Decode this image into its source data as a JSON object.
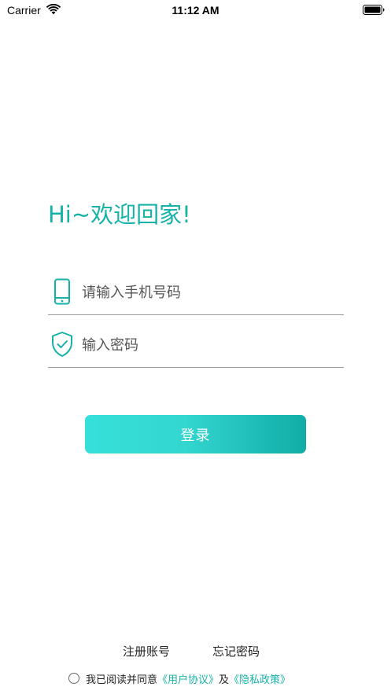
{
  "status_bar": {
    "carrier": "Carrier",
    "time": "11:12 AM",
    "icons": [
      "wifi-icon",
      "battery-icon"
    ]
  },
  "login": {
    "greeting": "Hi~欢迎回家!",
    "phone_placeholder": "请输入手机号码",
    "phone_icon": "phone-icon",
    "password_placeholder": "输入密码",
    "password_icon": "shield-check-icon",
    "login_button": "登录"
  },
  "links": {
    "register": "注册账号",
    "forgot_password": "忘记密码"
  },
  "agreement": {
    "prefix": "我已阅读并同意",
    "user_agreement": "《用户协议》",
    "conjunction": "及",
    "privacy_policy": "《隐私政策》",
    "checked": false
  },
  "colors": {
    "accent": "#16b2a8",
    "button_gradient_start": "#36e0da",
    "button_gradient_end": "#11aca6",
    "divider": "#9a9a9a"
  }
}
